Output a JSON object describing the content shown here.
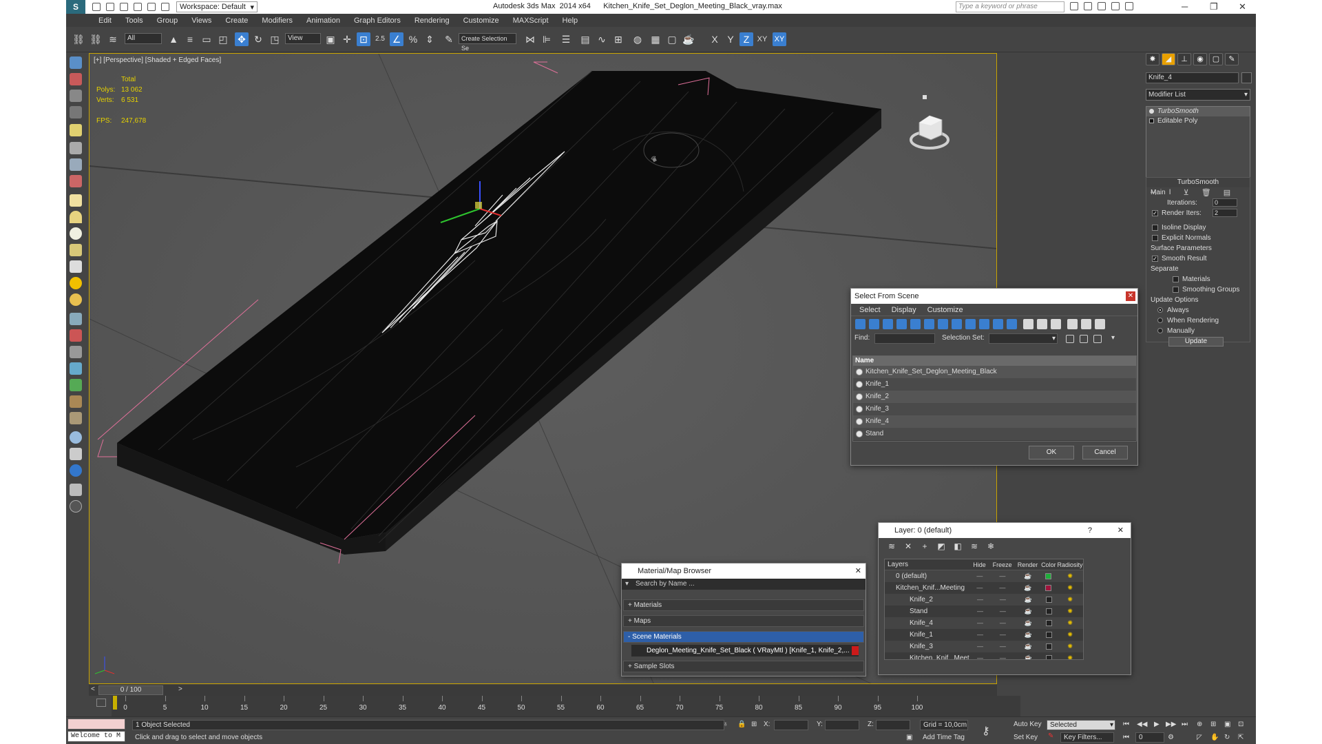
{
  "titlebar": {
    "workspace": "Workspace: Default",
    "title": "Autodesk 3ds Max  2014 x64      Kitchen_Knife_Set_Deglon_Meeting_Black_vray.max",
    "search_placeholder": "Type a keyword or phrase"
  },
  "menu": [
    "Edit",
    "Tools",
    "Group",
    "Views",
    "Create",
    "Modifiers",
    "Animation",
    "Graph Editors",
    "Rendering",
    "Customize",
    "MAXScript",
    "Help"
  ],
  "toolbar": {
    "filter": "All",
    "coord": "View",
    "snap_value": "2.5",
    "selection_set": "Create Selection Se",
    "axes": [
      "X",
      "Y",
      "Z",
      "XY",
      "XY"
    ]
  },
  "viewport": {
    "label": "[+] [Perspective] [Shaded + Edged Faces]",
    "stats": {
      "header": "Total",
      "polys_label": "Polys:",
      "polys": "13 062",
      "verts_label": "Verts:",
      "verts": "6 531",
      "fps_label": "FPS:",
      "fps": "247,678"
    }
  },
  "command_panel": {
    "object_name": "Knife_4",
    "modifier_list": "Modifier List",
    "stack": [
      "TurboSmooth",
      "Editable Poly"
    ],
    "rollout_title": "TurboSmooth",
    "main": "Main",
    "iterations_label": "Iterations:",
    "iterations": "0",
    "render_iters_label": "Render Iters:",
    "render_iters": "2",
    "isoline": "Isoline Display",
    "explicit_normals": "Explicit Normals",
    "surface_params": "Surface Parameters",
    "smooth_result": "Smooth Result",
    "separate": "Separate",
    "materials": "Materials",
    "smoothing_groups": "Smoothing Groups",
    "update_options": "Update Options",
    "always": "Always",
    "when_rendering": "When Rendering",
    "manually": "Manually",
    "update": "Update"
  },
  "select_from_scene": {
    "title": "Select From Scene",
    "menu": [
      "Select",
      "Display",
      "Customize"
    ],
    "find_label": "Find:",
    "selection_set_label": "Selection Set:",
    "column": "Name",
    "rows": [
      "Kitchen_Knife_Set_Deglon_Meeting_Black",
      "Knife_1",
      "Knife_2",
      "Knife_3",
      "Knife_4",
      "Stand"
    ],
    "ok": "OK",
    "cancel": "Cancel"
  },
  "material_browser": {
    "title": "Material/Map Browser",
    "search": "Search by Name ...",
    "groups": [
      "+ Materials",
      "+ Maps",
      "- Scene Materials",
      "+ Sample Slots"
    ],
    "scene_material": "Deglon_Meeting_Knife_Set_Black  ( VRayMtl )  [Knife_1, Knife_2,..."
  },
  "layers": {
    "title": "Layer: 0 (default)",
    "columns": [
      "Layers",
      "Hide",
      "Freeze",
      "Render",
      "Color",
      "Radiosity"
    ],
    "rows": [
      {
        "name": "0 (default)",
        "color": "#1fae3a"
      },
      {
        "name": "Kitchen_Knif...Meeting",
        "color": "#a0143c"
      },
      {
        "name": "Knife_2",
        "color": "#222222"
      },
      {
        "name": "Stand",
        "color": "#222222"
      },
      {
        "name": "Knife_4",
        "color": "#222222"
      },
      {
        "name": "Knife_1",
        "color": "#222222"
      },
      {
        "name": "Knife_3",
        "color": "#222222"
      },
      {
        "name": "Kitchen_Knif...Meet",
        "color": "#222222"
      }
    ]
  },
  "timeline": {
    "frame": "0 / 100",
    "ticks": [
      "0",
      "5",
      "10",
      "15",
      "20",
      "25",
      "30",
      "35",
      "40",
      "45",
      "50",
      "55",
      "60",
      "65",
      "70",
      "75",
      "80",
      "85",
      "90",
      "95",
      "100"
    ]
  },
  "status": {
    "maxscript": "Welcome to M",
    "selected": "1 Object Selected",
    "prompt": "Click and drag to select and move objects",
    "x": "X:",
    "y": "Y:",
    "z": "Z:",
    "grid": "Grid = 10,0cm",
    "add_time_tag": "Add Time Tag",
    "auto_key": "Auto Key",
    "set_key": "Set Key",
    "selected_dropdown": "Selected",
    "key_filters": "Key Filters...",
    "frame_field": "0"
  }
}
